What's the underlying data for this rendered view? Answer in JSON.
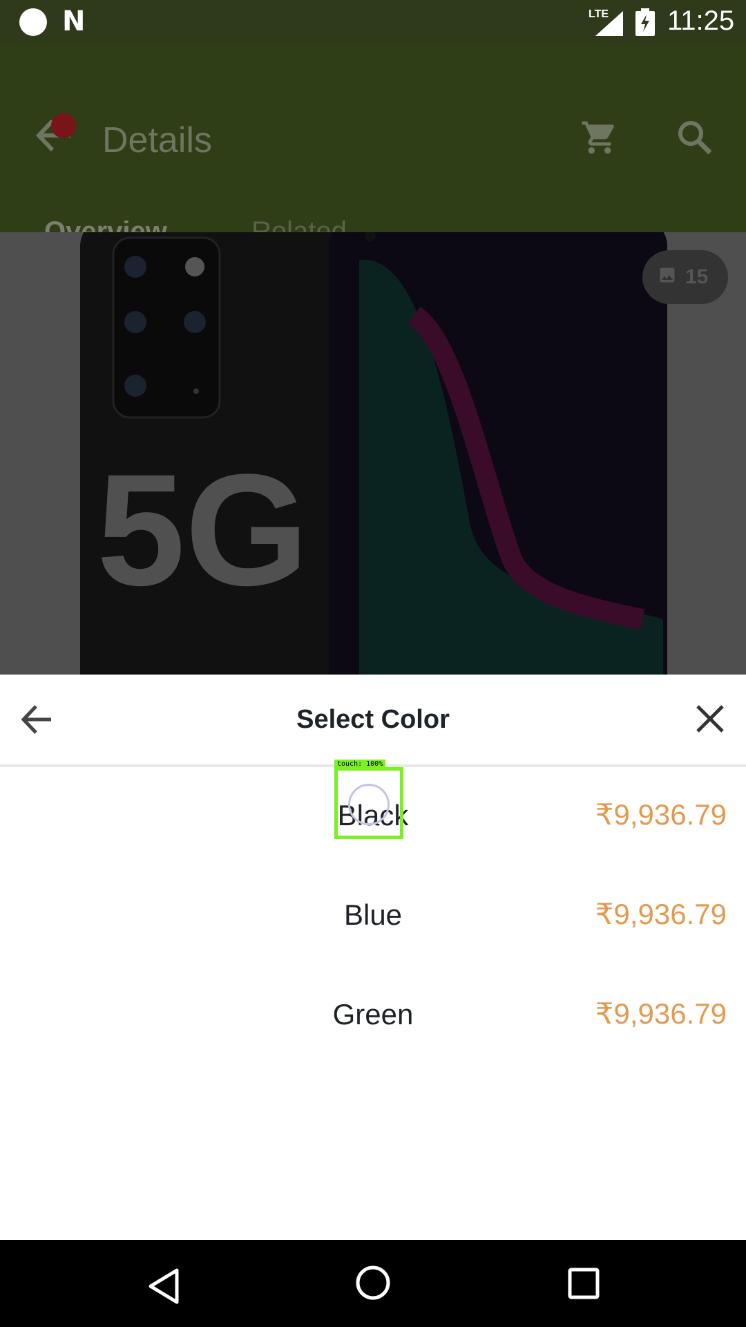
{
  "status_bar": {
    "network": "LTE",
    "time": "11:25",
    "icons": [
      "notification-dot-icon",
      "n-logo-icon",
      "signal-icon",
      "battery-charging-icon"
    ]
  },
  "app_bar": {
    "title": "Details",
    "icons": [
      "back-arrow-icon",
      "cart-icon",
      "search-icon"
    ],
    "tabs": [
      {
        "label": "Overview",
        "selected": true
      },
      {
        "label": "Related",
        "selected": false
      }
    ]
  },
  "product_image": {
    "headline": "5G",
    "image_count": "15"
  },
  "color_sheet": {
    "title": "Select Color",
    "options": [
      {
        "name": "Black",
        "price": "₹9,936.79"
      },
      {
        "name": "Blue",
        "price": "₹9,936.79"
      },
      {
        "name": "Green",
        "price": "₹9,936.79"
      }
    ],
    "price_color": "#e39a4e"
  },
  "touch_overlay": {
    "label": "touch: 100%"
  },
  "colors": {
    "app_bar": "#303e18",
    "status_bar": "#2f3a1a"
  }
}
